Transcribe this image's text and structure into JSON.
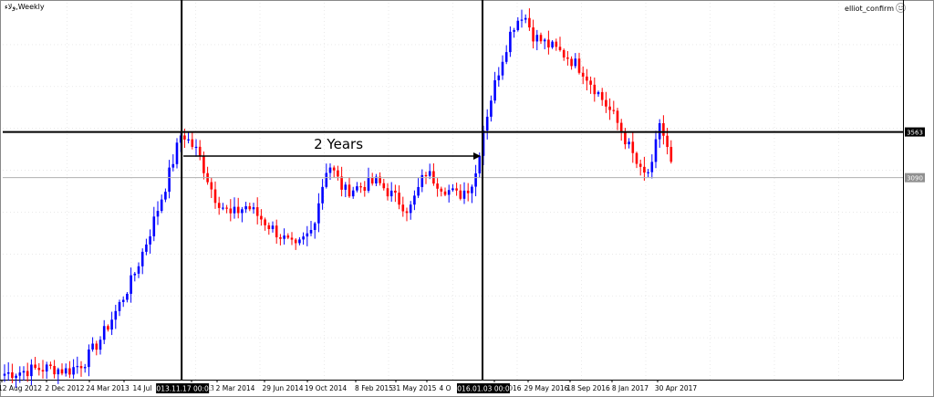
{
  "window": {
    "symbol_title": "ولاء,Weekly",
    "indicator_label": "elliot_confirm",
    "indicator_icon": "smiley-icon"
  },
  "colors": {
    "bull": "#0000ff",
    "bear": "#ff0000",
    "grid": "#dcdcdc",
    "ref_line": "#b0b0b0"
  },
  "chart_data": {
    "type": "candlestick",
    "title": "",
    "xlabel": "",
    "ylabel": "",
    "ylim": [
      1000,
      4900
    ],
    "grid": true,
    "x_tick_labels": [
      "12 Aug 2012",
      "2 Dec 2012",
      "24 Mar 2013",
      "14 Jul",
      "13",
      "2 Mar 2014",
      "29 Jun 2014",
      "19 Oct 2014",
      "8 Feb 2015",
      "31 May 2015",
      "4 O",
      "2016",
      "29 May 2016",
      "18 Sep 2016",
      "8 Jan 2017",
      "30 Apr 2017"
    ],
    "price_tags": {
      "upper": "3563",
      "lower": "3090"
    },
    "horizontal_lines": [
      3563,
      3090
    ],
    "vertical_markers": [
      {
        "date": "2013-11-17",
        "label": "2013.11.17 00:00"
      },
      {
        "date": "2016.01.03",
        "label": "2016.01.03 00:00"
      }
    ],
    "annotation": "2 Years",
    "series": [
      {
        "phase": "rise",
        "start_date": "2012-08-12",
        "end_date": "2013-11-17",
        "start": 1060,
        "end": 3560
      },
      {
        "phase": "range",
        "start_date": "2013-11-17",
        "end_date": "2016-01-03",
        "low": 2200,
        "high": 3560
      },
      {
        "phase": "breakout",
        "start_date": "2016-01-03",
        "end_date": "2016-04-17",
        "start": 3560,
        "end": 4800
      },
      {
        "phase": "decline",
        "start_date": "2016-04-17",
        "end_date": "2017-05-14",
        "start": 4800,
        "end": 3000
      }
    ],
    "close_path": [
      [
        "2012-08-12",
        1060
      ],
      [
        "2012-09-23",
        1080
      ],
      [
        "2012-11-04",
        1110
      ],
      [
        "2012-12-16",
        1120
      ],
      [
        "2013-01-27",
        1090
      ],
      [
        "2013-03-10",
        1180
      ],
      [
        "2013-04-21",
        1420
      ],
      [
        "2013-06-02",
        1720
      ],
      [
        "2013-07-14",
        2050
      ],
      [
        "2013-08-25",
        2500
      ],
      [
        "2013-10-06",
        3000
      ],
      [
        "2013-11-17",
        3560
      ],
      [
        "2013-12-29",
        3350
      ],
      [
        "2014-02-09",
        2900
      ],
      [
        "2014-03-23",
        2700
      ],
      [
        "2014-05-04",
        2800
      ],
      [
        "2014-06-15",
        2650
      ],
      [
        "2014-07-27",
        2500
      ],
      [
        "2014-09-07",
        2350
      ],
      [
        "2014-10-19",
        2550
      ],
      [
        "2014-11-30",
        3250
      ],
      [
        "2015-01-11",
        2950
      ],
      [
        "2015-02-22",
        3000
      ],
      [
        "2015-04-05",
        3050
      ],
      [
        "2015-05-17",
        2900
      ],
      [
        "2015-06-28",
        2750
      ],
      [
        "2015-08-09",
        3150
      ],
      [
        "2015-09-20",
        3000
      ],
      [
        "2015-11-01",
        2900
      ],
      [
        "2015-12-13",
        3050
      ],
      [
        "2016-01-03",
        3560
      ],
      [
        "2016-01-24",
        3900
      ],
      [
        "2016-02-21",
        4300
      ],
      [
        "2016-03-20",
        4650
      ],
      [
        "2016-04-17",
        4800
      ],
      [
        "2016-05-15",
        4550
      ],
      [
        "2016-06-26",
        4450
      ],
      [
        "2016-08-07",
        4350
      ],
      [
        "2016-09-18",
        4200
      ],
      [
        "2016-10-30",
        3950
      ],
      [
        "2016-12-11",
        3700
      ],
      [
        "2017-01-22",
        3350
      ],
      [
        "2017-02-19",
        3100
      ],
      [
        "2017-03-19",
        3200
      ],
      [
        "2017-04-02",
        3700
      ],
      [
        "2017-04-23",
        3400
      ],
      [
        "2017-05-14",
        3050
      ]
    ]
  }
}
